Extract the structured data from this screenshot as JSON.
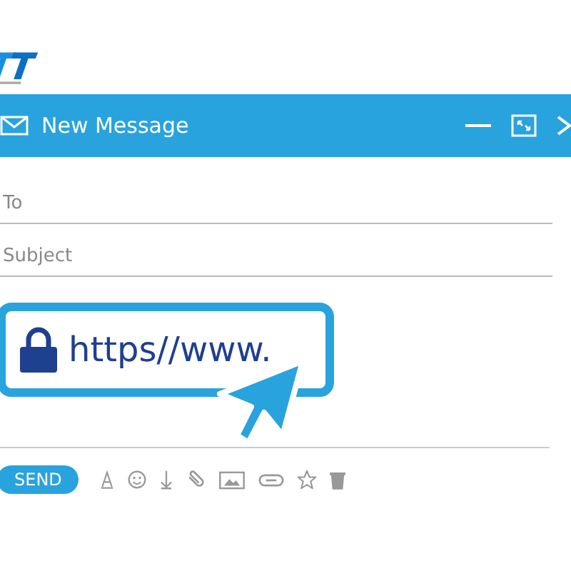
{
  "window": {
    "title": "New Message"
  },
  "fields": [
    {
      "placeholder": "To"
    },
    {
      "placeholder": "Subject"
    }
  ],
  "address_bar": {
    "text": "https//www."
  },
  "send_button": {
    "label": "SEND"
  }
}
